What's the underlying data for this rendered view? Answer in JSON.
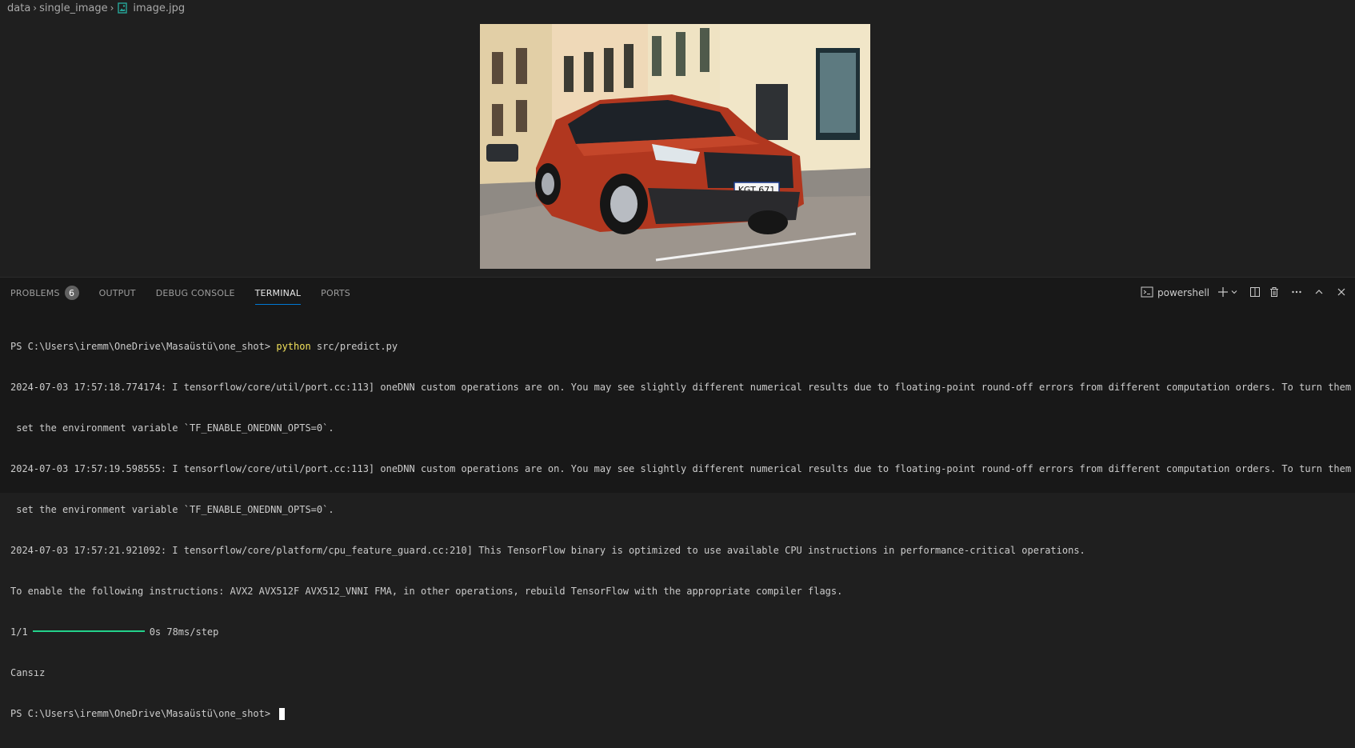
{
  "breadcrumb": {
    "segments": [
      "data",
      "single_image",
      "image.jpg"
    ]
  },
  "image": {
    "description": "photo"
  },
  "panel": {
    "tabs": [
      {
        "label": "PROBLEMS",
        "badge": "6"
      },
      {
        "label": "OUTPUT"
      },
      {
        "label": "DEBUG CONSOLE"
      },
      {
        "label": "TERMINAL",
        "active": true
      },
      {
        "label": "PORTS"
      }
    ],
    "shell_label": "powershell"
  },
  "terminal": {
    "prompt1": "PS C:\\Users\\iremm\\OneDrive\\Masaüstü\\one_shot> ",
    "command1_exe": "python",
    "command1_args": " src/predict.py",
    "line2": "2024-07-03 17:57:18.774174: I tensorflow/core/util/port.cc:113] oneDNN custom operations are on. You may see slightly different numerical results due to floating-point round-off errors from different computation orders. To turn them off,",
    "line3": " set the environment variable `TF_ENABLE_ONEDNN_OPTS=0`.",
    "line4": "2024-07-03 17:57:19.598555: I tensorflow/core/util/port.cc:113] oneDNN custom operations are on. You may see slightly different numerical results due to floating-point round-off errors from different computation orders. To turn them off,",
    "line5": " set the environment variable `TF_ENABLE_ONEDNN_OPTS=0`.",
    "line6": "2024-07-03 17:57:21.921092: I tensorflow/core/platform/cpu_feature_guard.cc:210] This TensorFlow binary is optimized to use available CPU instructions in performance-critical operations.",
    "line7": "To enable the following instructions: AVX2 AVX512F AVX512_VNNI FMA, in other operations, rebuild TensorFlow with the appropriate compiler flags.",
    "progress_step": "1/1",
    "progress_fraction": 1.0,
    "progress_text": "0s 78ms/step",
    "result": "Cansız",
    "prompt2": "PS C:\\Users\\iremm\\OneDrive\\Masaüstü\\one_shot> "
  },
  "colors": {
    "accent": "#0078d4",
    "progress": "#23d18b",
    "command": "#f1e05a"
  }
}
